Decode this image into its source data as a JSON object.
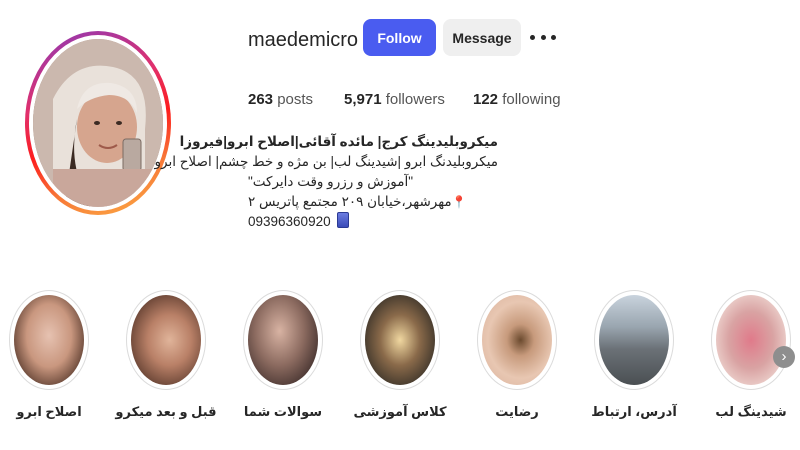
{
  "profile": {
    "username": "maedemicro",
    "follow_label": "Follow",
    "message_label": "Message",
    "more_icon": "more-horizontal-icon",
    "avatar_icon": "avatar",
    "ring_colors": [
      "#8a3ab9",
      "#e1306c",
      "#fd1d1d",
      "#f77737",
      "#fcaf45"
    ]
  },
  "stats": {
    "posts_count": "263",
    "posts_label": "posts",
    "followers_count": "5,971",
    "followers_label": "followers",
    "following_count": "122",
    "following_label": "following"
  },
  "bio": {
    "name": "میکروبلیدینگ کرج| مائده آقائی|اصلاح ابرو|فیروزا",
    "line1": "میکروبلیدنگ ابرو |شیدینگ لب| بن مژه و خط چشم| اصلاح ابرو",
    "line2": "\"آموزش و رزرو وقت دایرکت\"",
    "line3": "مهرشهر،خیابان ۲۰۹ مجتمع پاتریس ۲",
    "pin_icon": "location-pin-icon",
    "phone": "09396360920",
    "phone_icon": "phone-icon"
  },
  "highlights": [
    {
      "label": "اصلاح ابرو"
    },
    {
      "label": "قبل و بعد میکرو"
    },
    {
      "label": "سوالات شما"
    },
    {
      "label": "کلاس آموزشی"
    },
    {
      "label": "رضایت"
    },
    {
      "label": "آدرس، ارتباط"
    },
    {
      "label": "شیدینگ لب"
    }
  ],
  "next_arrow": "chevron-right-icon",
  "colors": {
    "follow_button": "#4a5cf0",
    "message_button": "#efefef",
    "text": "#262626"
  }
}
